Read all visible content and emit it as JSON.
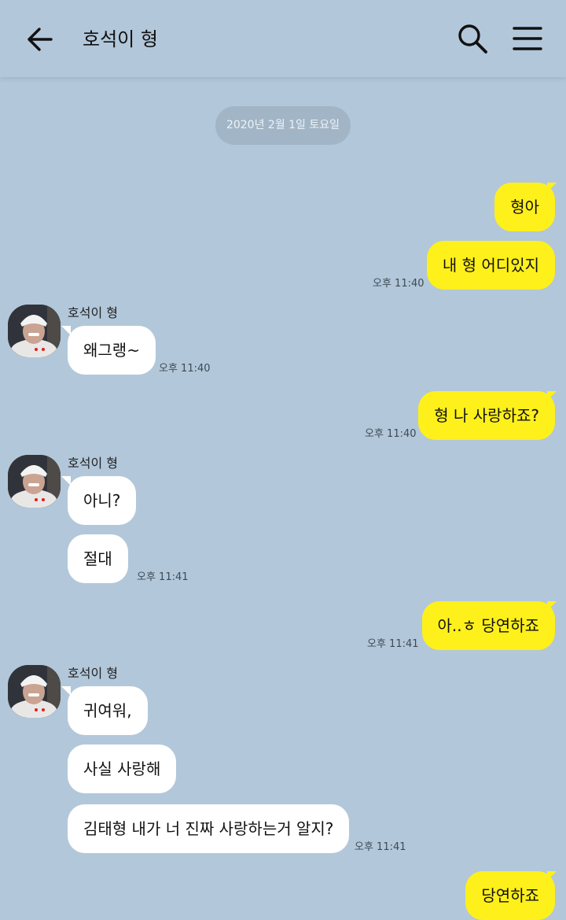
{
  "header": {
    "title": "호석이 형"
  },
  "date_divider": "2020년 2월 1일 토요일",
  "messages": {
    "m1": "형아",
    "m2": "내 형 어디있지",
    "t2": "오후 11:40",
    "n3": "호석이 형",
    "m3": "왜그랭~",
    "t3": "오후 11:40",
    "m4": "형 나 사랑하죠?",
    "t4": "오후 11:40",
    "n5": "호석이 형",
    "m5": "아니?",
    "m6": "절대",
    "t6": "오후 11:41",
    "m7": "아..ㅎ 당연하죠",
    "t7": "오후 11:41",
    "n8": "호석이 형",
    "m8": "귀여워,",
    "m9": "사실 사랑해",
    "m10": "김태형 내가 너 진짜 사랑하는거 알지?",
    "t10": "오후 11:41",
    "m11": "당연하죠"
  },
  "colors": {
    "background": "#b2c7da",
    "my_bubble": "#fef01b",
    "their_bubble": "#ffffff"
  }
}
